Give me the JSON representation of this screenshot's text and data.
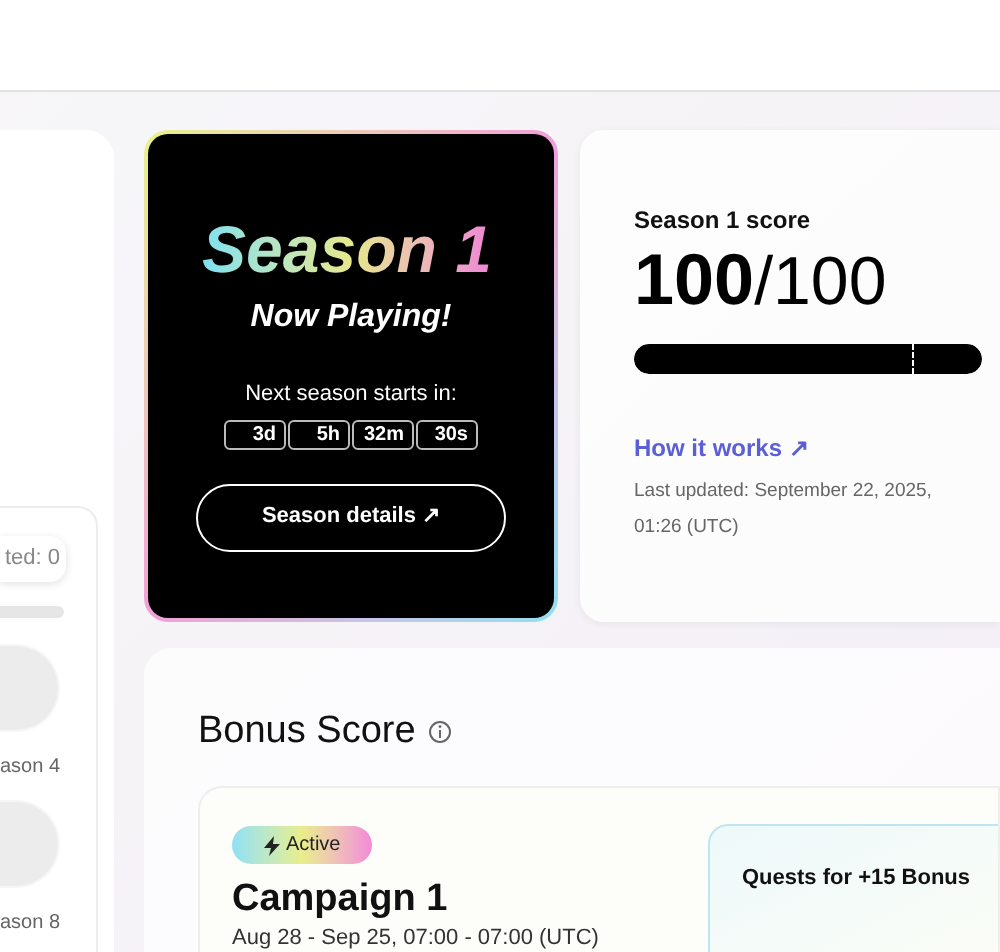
{
  "side_panel": {
    "pill": "ted: 0",
    "seasons": [
      {
        "label": "ason 4"
      },
      {
        "label": "ason 8"
      }
    ]
  },
  "season_card": {
    "title": "Season 1",
    "subtitle": "Now Playing!",
    "countdown_label": "Next season starts in:",
    "countdown": [
      "3d",
      "5h",
      "32m",
      "30s"
    ],
    "button": "Season details ↗"
  },
  "score_card": {
    "title": "Season 1 score",
    "score": "100",
    "total": "/100",
    "level": 1,
    "link": "How it works ↗",
    "updated": "Last updated: September 22, 2025, 01:26 (UTC)"
  },
  "bonus": {
    "title": "Bonus Score",
    "campaign": {
      "badge": "Active",
      "title": "Campaign 1",
      "dates": "Aug 28 - Sep 25, 07:00 - 07:00 (UTC)"
    },
    "quests_title": "Quests for +15 Bonus"
  }
}
